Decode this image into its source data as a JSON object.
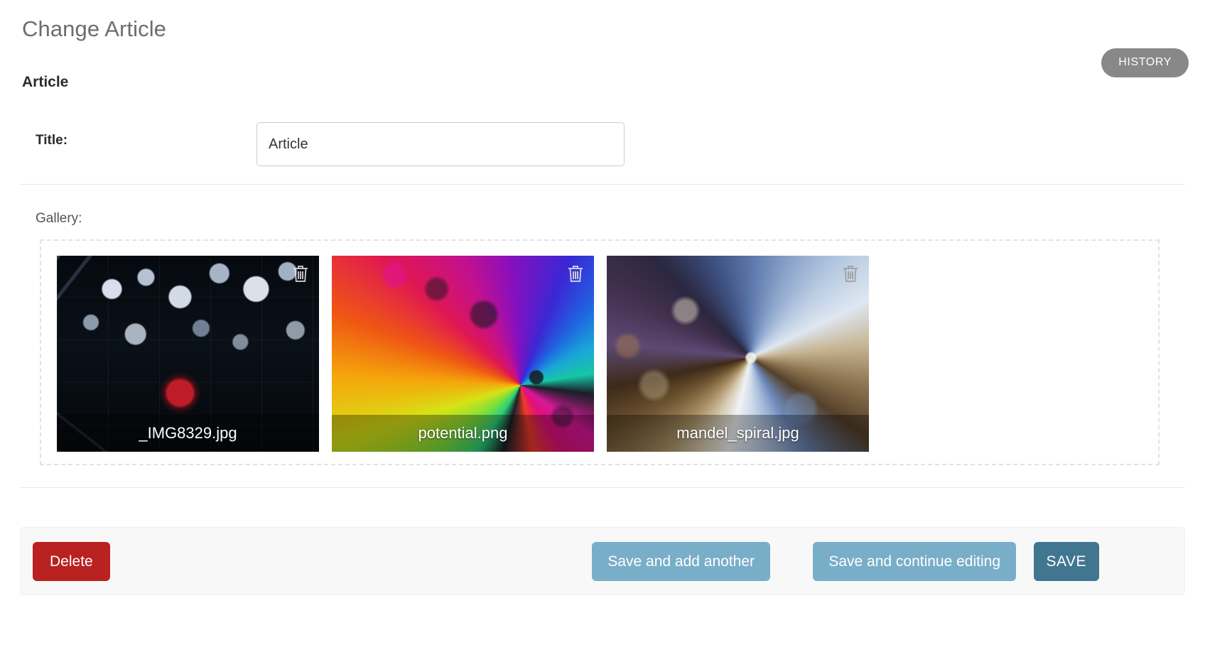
{
  "header": {
    "page_title": "Change Article",
    "history_label": "HISTORY"
  },
  "form": {
    "section_title": "Article",
    "title_field": {
      "label": "Title:",
      "value": "Article",
      "placeholder": ""
    },
    "gallery": {
      "label": "Gallery:",
      "items": [
        {
          "filename": "_IMG8329.jpg",
          "delete_icon": "trash-icon"
        },
        {
          "filename": "potential.png",
          "delete_icon": "trash-icon"
        },
        {
          "filename": "mandel_spiral.jpg",
          "delete_icon": "trash-icon"
        }
      ]
    }
  },
  "actions": {
    "delete_label": "Delete",
    "save_add_another_label": "Save and add another",
    "save_continue_label": "Save and continue editing",
    "save_label": "SAVE"
  },
  "colors": {
    "delete_red": "#ba2121",
    "save_blue": "#79aec8",
    "save_primary": "#417690",
    "history_gray": "#888888"
  }
}
